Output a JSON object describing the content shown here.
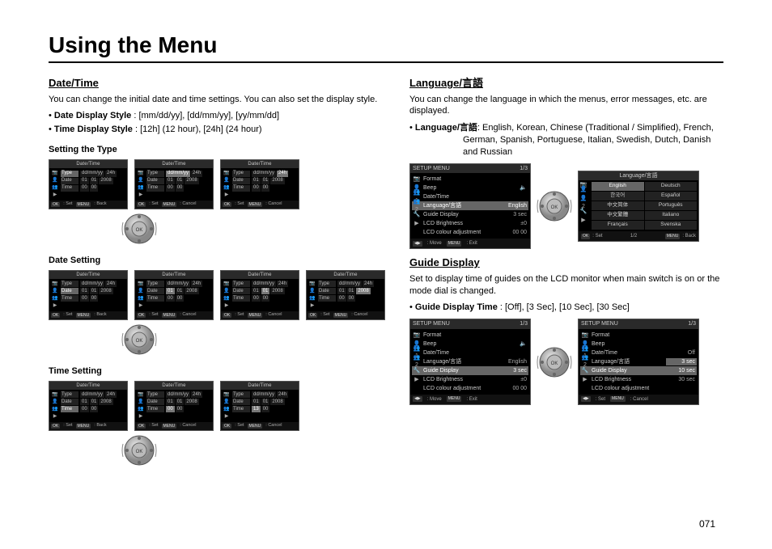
{
  "page_number": "071",
  "title": "Using the Menu",
  "left": {
    "h": "Date/Time",
    "intro": "You can change the initial date and time settings. You can also set the display style.",
    "bul1_label": "Date Display Style",
    "bul1_vals": " :  [mm/dd/yy], [dd/mm/yy], [yy/mm/dd]",
    "bul2_label": "Time Display Style",
    "bul2_vals": " :  [12h] (12 hour), [24h] (24 hour)",
    "sub1": "Setting the Type",
    "sub2": "Date Setting",
    "sub3": "Time Setting"
  },
  "right": {
    "lang_h": "Language/言語",
    "lang_intro": "You can change the language in which the menus, error messages, etc. are displayed.",
    "lang_bul_label": "Language/言語",
    "lang_bul_vals": ": English, Korean, Chinese (Traditional / Simplified), French, German, Spanish, Portuguese, Italian, Swedish, Dutch, Danish and Russian",
    "guide_h": "Guide Display",
    "guide_intro": "Set to display time of guides on the LCD monitor when main switch is on or the mode dial is changed.",
    "guide_bul_label": "Guide Display Time",
    "guide_bul_vals": " : [Off], [3 Sec], [10 Sec], [30 Sec]"
  },
  "lcd": {
    "title": "Date/Time",
    "rows": {
      "type": "Type",
      "date": "Date",
      "time": "Time"
    },
    "type_val": "dd/mm/yy",
    "type_val2": "24h",
    "date_v": [
      "01",
      "01",
      "2008"
    ],
    "time_v": [
      "00",
      "00"
    ],
    "time_v2": [
      "13",
      "00"
    ],
    "foot_ok": "OK",
    "foot_set": ": Set",
    "foot_menu": "MENU",
    "foot_back": ": Back",
    "foot_cancel": ": Cancel"
  },
  "setup": {
    "title": "SETUP MENU",
    "pg": "1/3",
    "items": [
      "Format",
      "Beep",
      "Date/Time",
      "Language/言語",
      "Guide Display",
      "LCD Brightness",
      "LCD colour adjustment"
    ],
    "vals": [
      "",
      "🔈",
      "",
      "English",
      "3 sec",
      "±0",
      "00 00"
    ],
    "foot_move": ": Move",
    "foot_exit": ": Exit",
    "foot_set": ": Set",
    "foot_cancel": ": Cancel",
    "foot_back": ": Back"
  },
  "lang_screen": {
    "title": "Language/言語",
    "langs": [
      "English",
      "Deutsch",
      "한국어",
      "Español",
      "中文简体",
      "Português",
      "中文繁體",
      "Italiano",
      "Français",
      "Svenska"
    ],
    "pg": "1/2"
  },
  "guide_opts": {
    "title": "SETUP MENU",
    "pg": "1/3",
    "vals": [
      "Off",
      "3 sec",
      "10 sec",
      "30 sec"
    ]
  }
}
